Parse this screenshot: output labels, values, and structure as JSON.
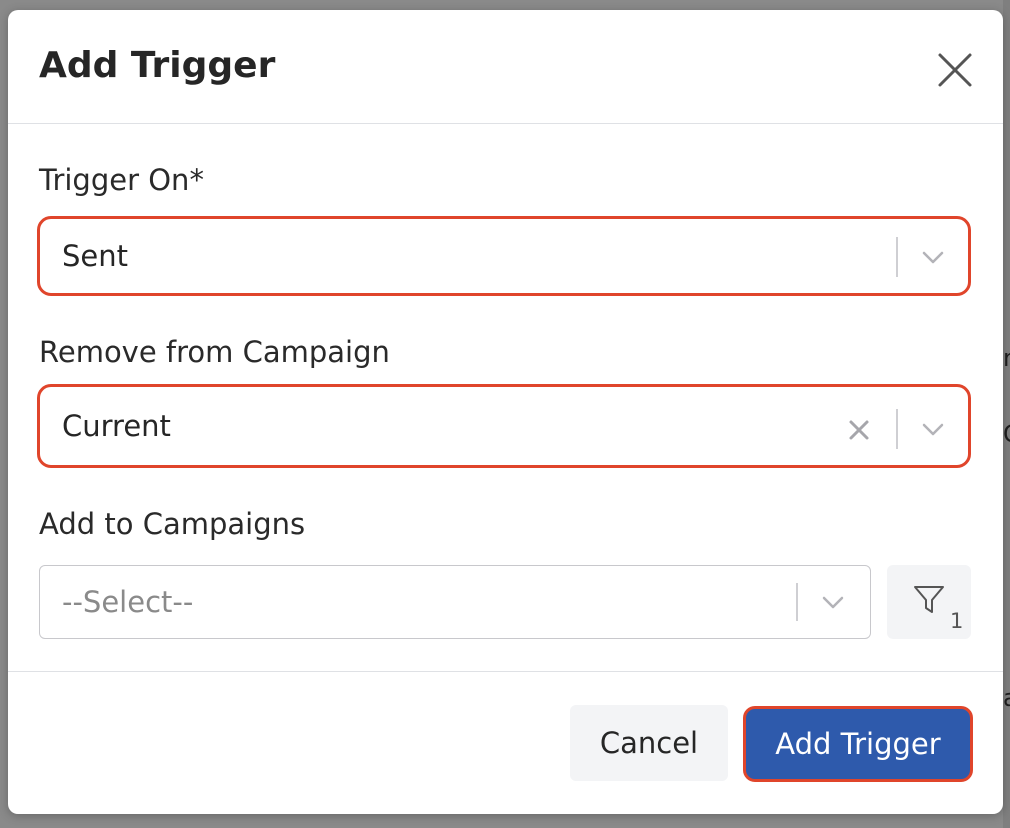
{
  "modal": {
    "title": "Add Trigger",
    "close_icon": "close-icon"
  },
  "fields": {
    "trigger_on": {
      "label": "Trigger On*",
      "value": "Sent"
    },
    "remove_from_campaign": {
      "label": "Remove from Campaign",
      "value": "Current"
    },
    "add_to_campaigns": {
      "label": "Add to Campaigns",
      "placeholder": "--Select--",
      "filter_count": "1"
    }
  },
  "footer": {
    "cancel_label": "Cancel",
    "submit_label": "Add Trigger"
  },
  "colors": {
    "primary": "#2e5aac",
    "highlight": "#e0452b"
  },
  "background": {
    "fragments": [
      "n",
      "C",
      "a"
    ]
  }
}
